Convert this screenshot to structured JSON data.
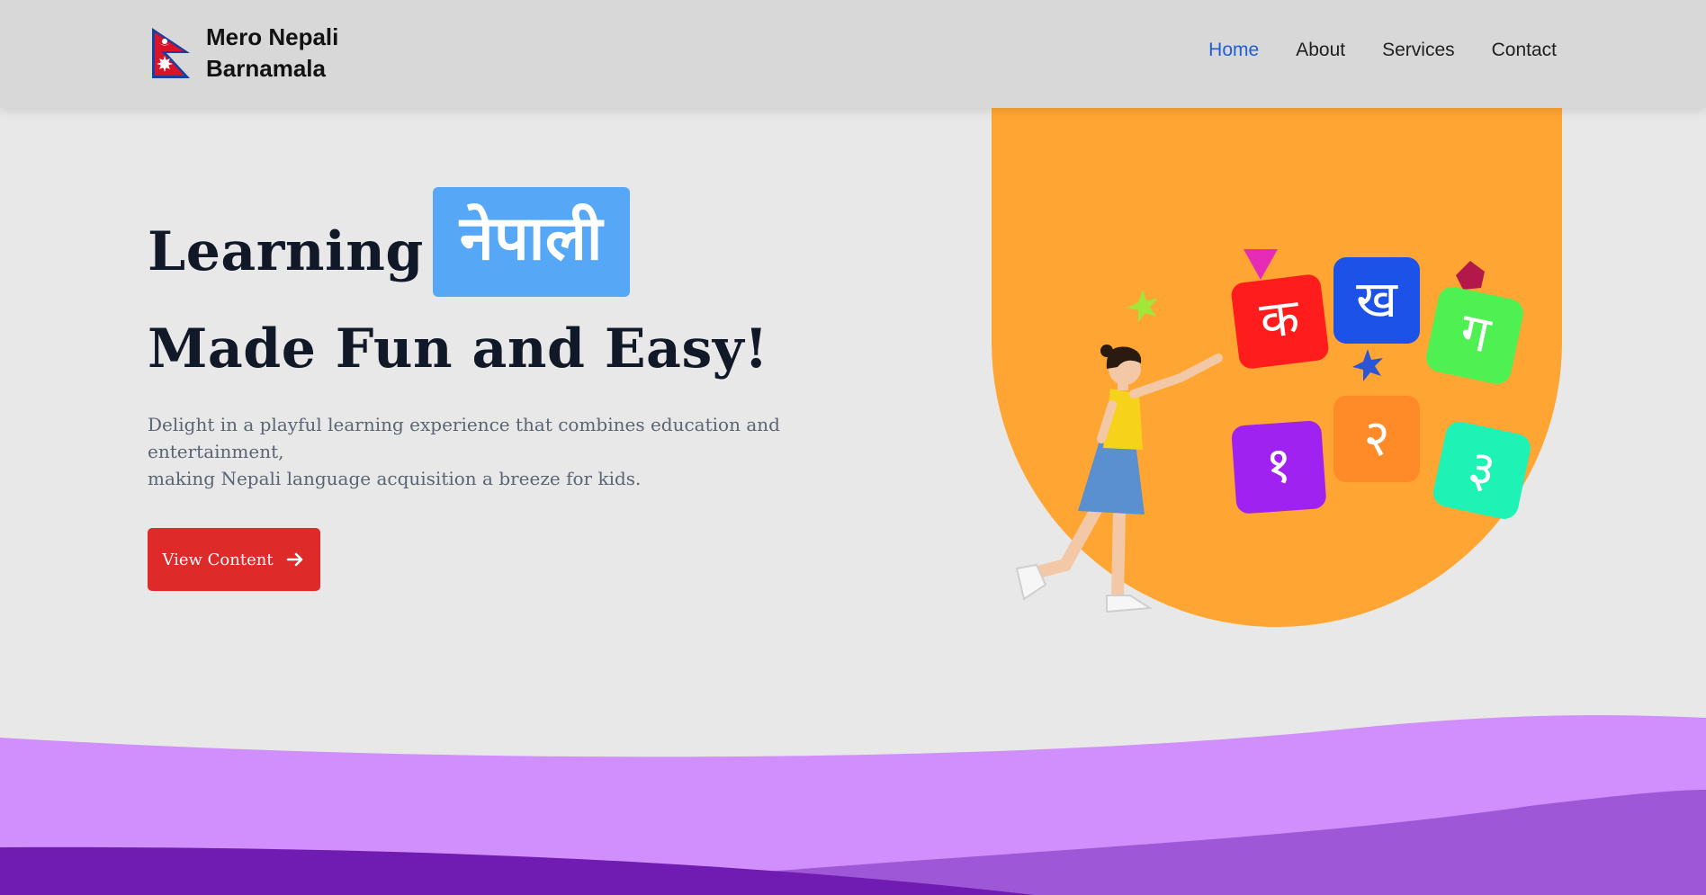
{
  "brand": {
    "line1": "Mero Nepali",
    "line2": "Barnamala",
    "logo_icon": "nepal-flag-icon"
  },
  "nav": {
    "items": [
      {
        "label": "Home",
        "active": true
      },
      {
        "label": "About",
        "active": false
      },
      {
        "label": "Services",
        "active": false
      },
      {
        "label": "Contact",
        "active": false
      }
    ]
  },
  "hero": {
    "title_prefix": "Learning",
    "title_highlight": "नेपाली",
    "title_line2": "Made Fun and Easy!",
    "description_line1": "Delight in a playful learning experience that combines education and entertainment,",
    "description_line2": "making Nepali language acquisition a breeze for kids.",
    "cta_label": "View Content",
    "cta_icon": "arrow-right-icon"
  },
  "illustration": {
    "letters": [
      "क",
      "ख",
      "ग"
    ],
    "numerals": [
      "१",
      "२",
      "३"
    ]
  },
  "colors": {
    "nav_active": "#1f5ddb",
    "highlight_bg": "#56a8f7",
    "cta_bg": "#df2a2a",
    "blob": "#ffa533",
    "wave_light": "#d08ffd",
    "wave_mid": "#9e57d6",
    "wave_dark": "#701cb2"
  }
}
